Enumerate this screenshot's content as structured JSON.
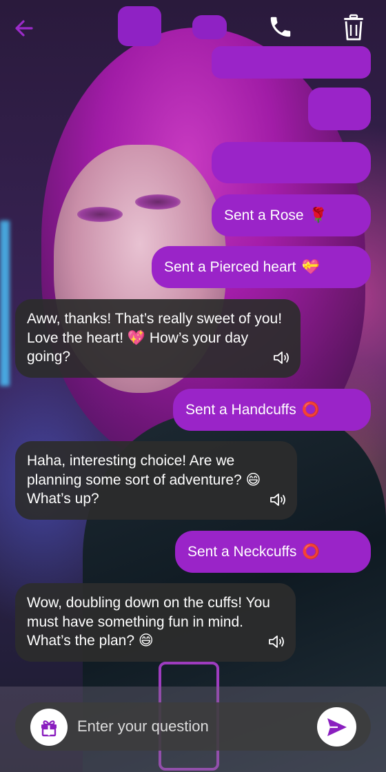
{
  "header": {
    "back_icon": "arrow-left-icon",
    "call_icon": "phone-icon",
    "delete_icon": "trash-icon",
    "accent_color": "#9b2bc9"
  },
  "messages": [
    {
      "type": "sent",
      "text": "Sent a Rose",
      "emoji": "🌹"
    },
    {
      "type": "sent",
      "text": "Sent a Pierced heart",
      "emoji": "💝"
    },
    {
      "type": "received",
      "text": "Aww, thanks! That’s really sweet of you! Love the heart! 💖 How’s your day going?"
    },
    {
      "type": "sent",
      "text": "Sent a Handcuffs",
      "emoji": "⭕"
    },
    {
      "type": "received",
      "text": "Haha, interesting choice! Are we planning some sort of adventure? 😄 What’s up?"
    },
    {
      "type": "sent",
      "text": "Sent a Neckcuffs",
      "emoji": "⭕"
    },
    {
      "type": "received",
      "text": "Wow, doubling down on the cuffs! You must have something fun in mind. What’s the plan? 😄"
    }
  ],
  "composer": {
    "placeholder": "Enter your question",
    "gift_icon": "gift-icon",
    "send_icon": "send-icon"
  },
  "colors": {
    "sent_bubble": "#9a24c8",
    "received_bubble": "#2c2c2c"
  }
}
